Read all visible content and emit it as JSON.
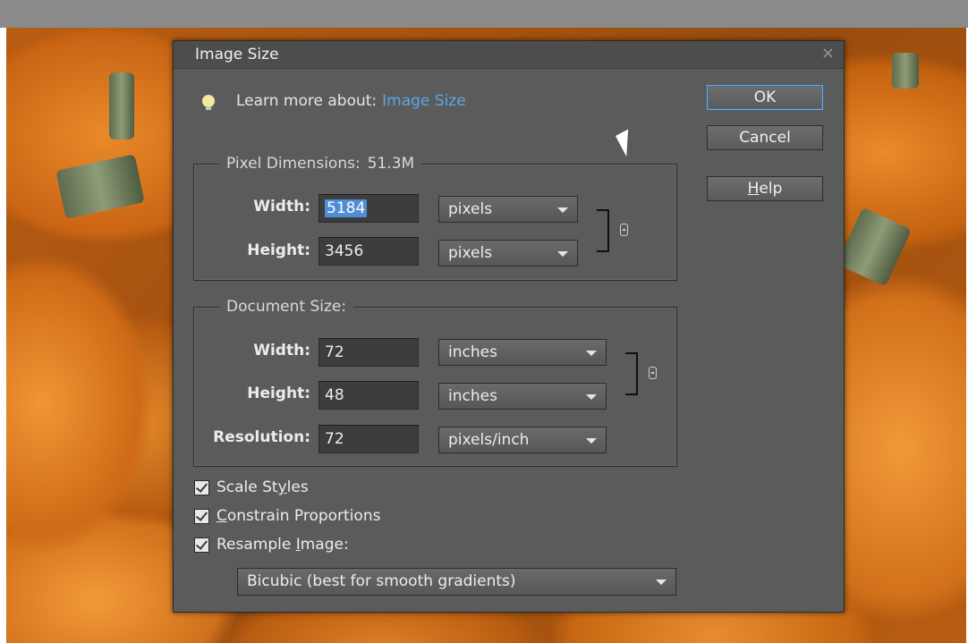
{
  "dialog": {
    "title": "Image Size",
    "close_icon": "close-icon",
    "learn_more": {
      "text": "Learn more about:",
      "link": "Image Size",
      "icon": "lightbulb-icon"
    },
    "buttons": {
      "ok": "OK",
      "cancel": "Cancel",
      "help_underlined": "H",
      "help_rest": "elp"
    },
    "pixel_dimensions": {
      "legend": "Pixel Dimensions:",
      "value": "51.3M",
      "width_label": "Width:",
      "width_value": "5184",
      "width_unit": "pixels",
      "height_label": "Height:",
      "height_value": "3456",
      "height_unit": "pixels"
    },
    "document_size": {
      "legend": "Document Size:",
      "width_label": "Width:",
      "width_value": "72",
      "width_unit": "inches",
      "height_label": "Height:",
      "height_value": "48",
      "height_unit": "inches",
      "resolution_label": "Resolution:",
      "resolution_value": "72",
      "resolution_unit": "pixels/inch"
    },
    "options": {
      "scale_styles_pre": "Scale St",
      "scale_styles_ul": "y",
      "scale_styles_post": "les",
      "constrain_ul": "C",
      "constrain_rest": "onstrain Proportions",
      "resample_pre": "Resample ",
      "resample_ul": "I",
      "resample_post": "mage:",
      "scale_styles_checked": true,
      "constrain_checked": true,
      "resample_checked": true,
      "resample_method": "Bicubic (best for smooth gradients)"
    }
  },
  "colors": {
    "dialog_bg": "#5b5b5b",
    "link": "#5fa6e6",
    "selection": "#4f8ed6",
    "backdrop_orange": "#d1701a"
  }
}
